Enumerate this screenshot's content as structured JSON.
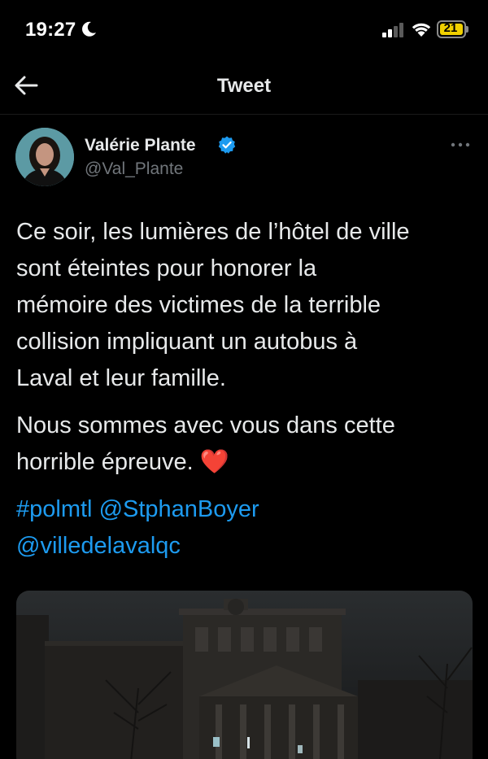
{
  "status_bar": {
    "time": "19:27",
    "battery": "21",
    "moon_icon": "moon-icon",
    "signal_icon": "cellular-signal-icon",
    "wifi_icon": "wifi-icon",
    "battery_color": "#f0d000"
  },
  "nav": {
    "back_icon": "arrow-left-icon",
    "title": "Tweet"
  },
  "tweet": {
    "author": {
      "name": "Valérie Plante",
      "handle": "@Val_Plante",
      "verified_icon": "verified-badge-icon",
      "verified_color": "#1d9bf0"
    },
    "more_icon": "more-horizontal-icon",
    "paragraphs": [
      {
        "lines": [
          "Ce soir, les lumières de l’hôtel de ville",
          "sont éteintes pour honorer la",
          "mémoire des victimes de la terrible",
          "collision impliquant un autobus à",
          "Laval et leur famille."
        ]
      },
      {
        "lines": [
          "Nous sommes avec vous dans cette",
          "horrible épreuve. "
        ],
        "emoji": "❤️"
      }
    ],
    "links": {
      "hashtag": "#polmtl",
      "mention_1": "@StphanBoyer",
      "mention_2": "@villedelavalqc"
    },
    "link_color": "#1d9bf0",
    "media": "photo-of-city-hall-at-night"
  }
}
